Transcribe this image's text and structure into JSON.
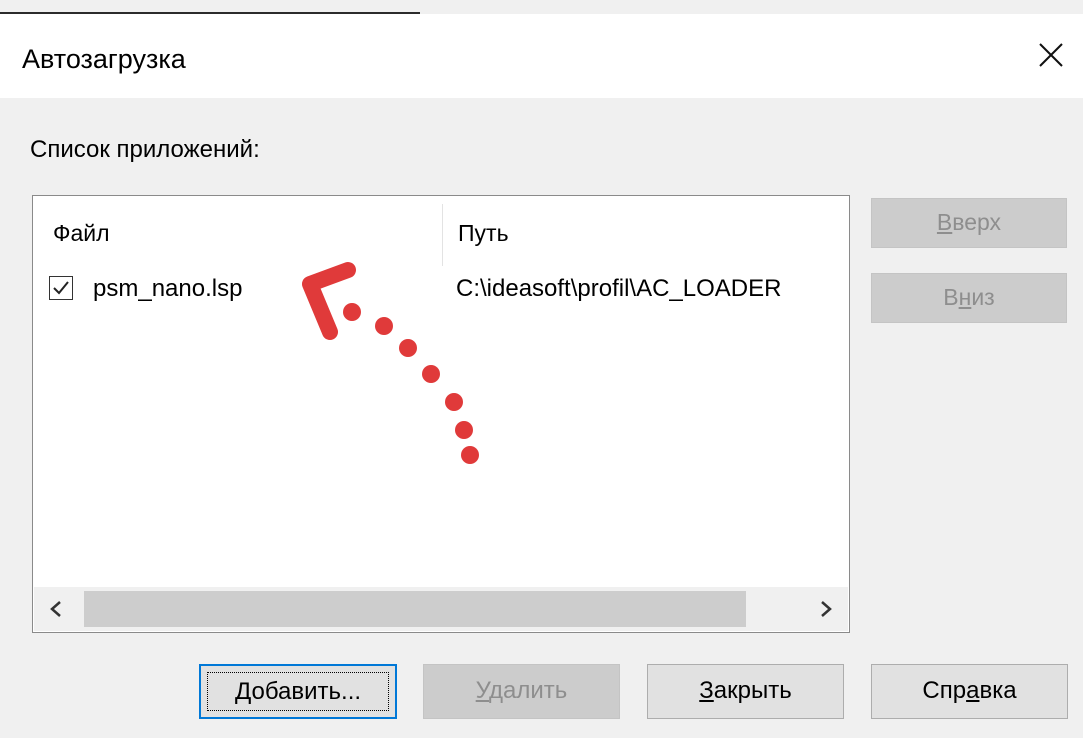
{
  "window": {
    "title": "Автозагрузка",
    "close_icon": "close-icon"
  },
  "list": {
    "label": "Список приложений:",
    "columns": [
      "Файл",
      "Путь"
    ],
    "rows": [
      {
        "checked": true,
        "file": "psm_nano.lsp",
        "path": "C:\\ideasoft\\profil\\AC_LOADER"
      }
    ]
  },
  "side_buttons": {
    "up": {
      "pre": "",
      "mnemonic": "В",
      "post": "верх"
    },
    "down": {
      "pre": "В",
      "mnemonic": "н",
      "post": "из"
    }
  },
  "bottom_buttons": {
    "add": {
      "pre": "",
      "mnemonic": "Д",
      "post": "обавить..."
    },
    "delete": {
      "pre": "",
      "mnemonic": "У",
      "post": "далить"
    },
    "close": {
      "pre": "",
      "mnemonic": "З",
      "post": "акрыть"
    },
    "help": {
      "pre": "Спр",
      "mnemonic": "а",
      "post": "вка"
    }
  },
  "colors": {
    "accent": "#0078d7",
    "annotation": "#e03a3a",
    "disabled_text": "#8e8e8e"
  }
}
